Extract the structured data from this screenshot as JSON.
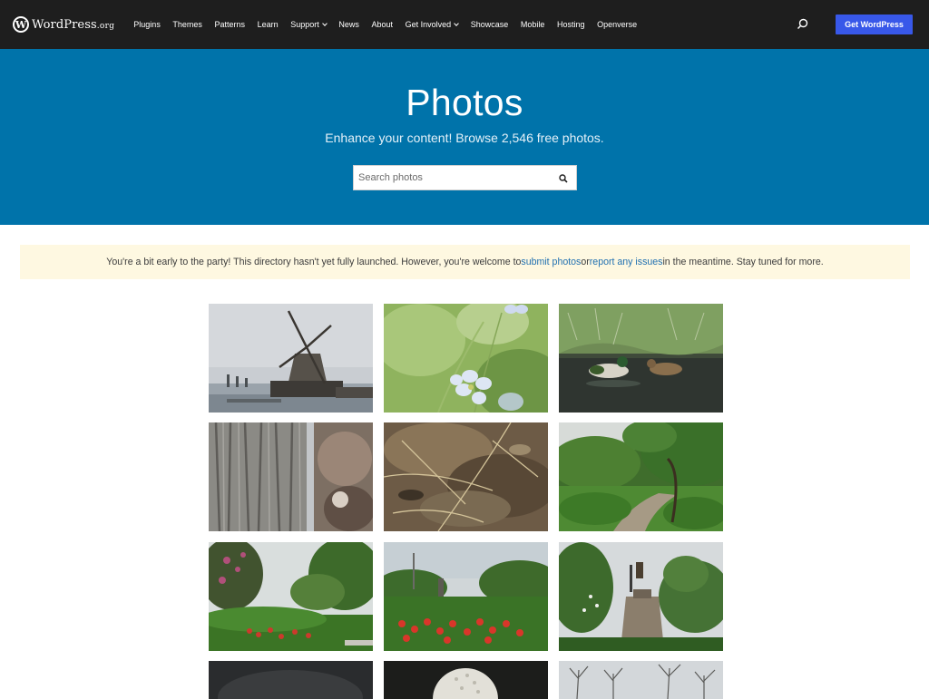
{
  "header": {
    "logo": {
      "word": "WordPress",
      "suffix": ".org"
    },
    "nav": [
      {
        "label": "Plugins",
        "dropdown": false
      },
      {
        "label": "Themes",
        "dropdown": false
      },
      {
        "label": "Patterns",
        "dropdown": false
      },
      {
        "label": "Learn",
        "dropdown": false
      },
      {
        "label": "Support",
        "dropdown": true
      },
      {
        "label": "News",
        "dropdown": false
      },
      {
        "label": "About",
        "dropdown": false
      },
      {
        "label": "Get Involved",
        "dropdown": true
      },
      {
        "label": "Showcase",
        "dropdown": false
      },
      {
        "label": "Mobile",
        "dropdown": false
      },
      {
        "label": "Hosting",
        "dropdown": false
      },
      {
        "label": "Openverse",
        "dropdown": false
      }
    ],
    "search_icon": "search-icon",
    "cta_label": "Get WordPress",
    "cta_color": "#3858e9",
    "bg_color": "#1e1e1e"
  },
  "hero": {
    "title": "Photos",
    "subtitle": "Enhance your content! Browse 2,546 free photos.",
    "search_placeholder": "Search photos",
    "bg_color": "#0073aa"
  },
  "notice": {
    "text_before": "You're a bit early to the party! This directory hasn't yet fully launched. However, you're welcome to ",
    "link1": "submit photos",
    "text_middle": " or ",
    "link2": "report any issues",
    "text_after": " in the meantime. Stay tuned for more.",
    "bg_color": "#fef8e1",
    "link_color": "#2271b1"
  },
  "photos": [
    {
      "subject": "windmill"
    },
    {
      "subject": "blue flower"
    },
    {
      "subject": "ducks in pond"
    },
    {
      "subject": "tree bark"
    },
    {
      "subject": "shallow water"
    },
    {
      "subject": "garden path"
    },
    {
      "subject": "park trees"
    },
    {
      "subject": "garden with red flowers"
    },
    {
      "subject": "statue monument"
    },
    {
      "subject": "dark photo"
    },
    {
      "subject": "dandelion seed head"
    },
    {
      "subject": "bare trees"
    }
  ]
}
